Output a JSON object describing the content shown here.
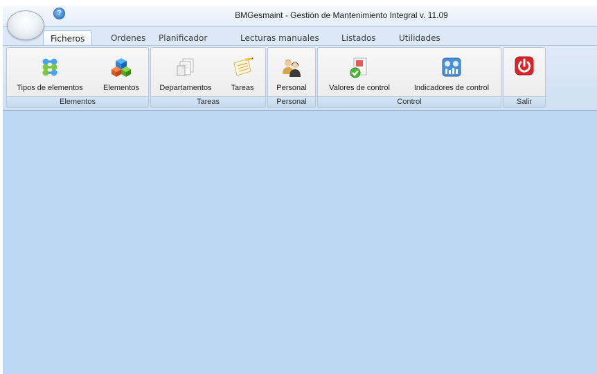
{
  "window": {
    "title": "BMGesmaint - Gestión de Mantenimiento Integral v. 11.09"
  },
  "help": {
    "glyph": "?"
  },
  "tabs": [
    "Ficheros",
    "Ordenes",
    "Planificador",
    "Lecturas manuales",
    "Listados",
    "Utilidades"
  ],
  "ribbon": {
    "groups": [
      {
        "label": "Elementos",
        "buttons": [
          "Tipos de elementos",
          "Elementos"
        ]
      },
      {
        "label": "Tareas",
        "buttons": [
          "Departamentos",
          "Tareas"
        ]
      },
      {
        "label": "Personal",
        "buttons": [
          "Personal"
        ]
      },
      {
        "label": "Control",
        "buttons": [
          "Valores de control",
          "Indicadores de control"
        ]
      },
      {
        "label": "Salir",
        "buttons": []
      }
    ]
  },
  "colors": {
    "workspace": "#bcd8f3",
    "exit_red": "#d9262b",
    "accent_blue": "#2d72c8"
  }
}
